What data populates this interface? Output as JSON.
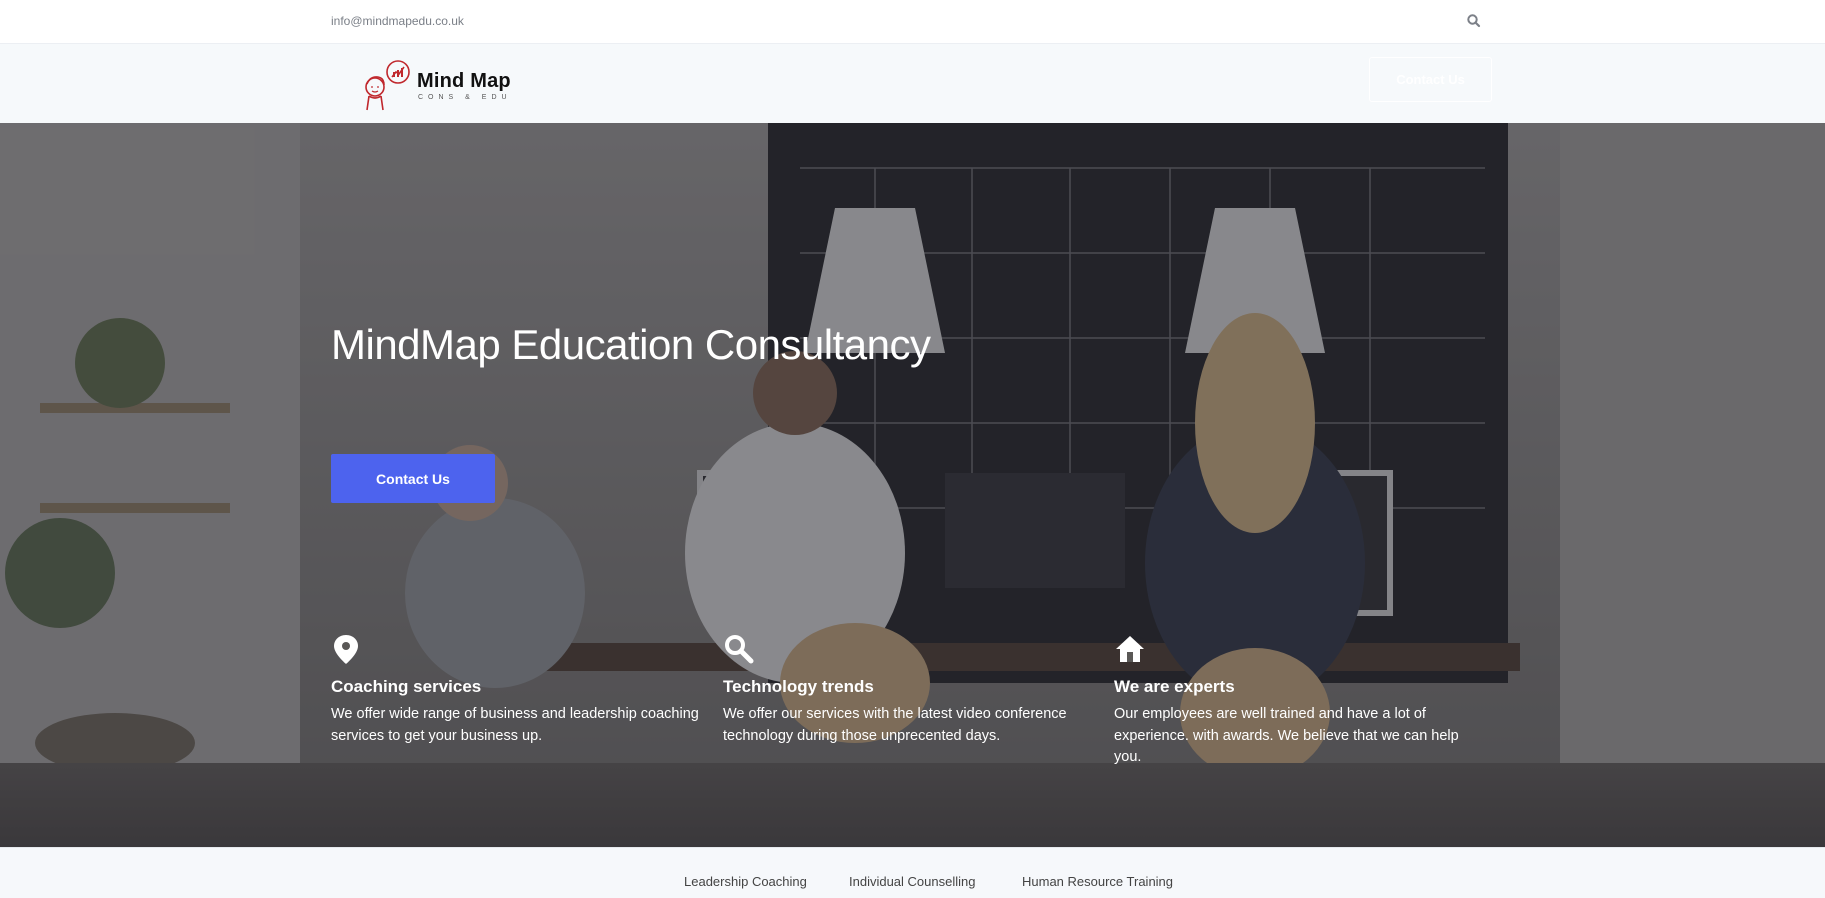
{
  "topbar": {
    "email": "info@mindmapedu.co.uk",
    "search_icon": "search-icon"
  },
  "header": {
    "logo": {
      "name": "Mind Map",
      "tagline": "CONS & EDU"
    },
    "cta_label": "Contact Us"
  },
  "hero": {
    "title": "MindMap Education Consultancy",
    "cta_label": "Contact Us",
    "features": [
      {
        "icon": "map-pin-icon",
        "title": "Coaching services",
        "text": "We offer wide range of business and leadership coaching services to get your business up."
      },
      {
        "icon": "search-icon",
        "title": "Technology trends",
        "text": "We offer our services with the latest video conference technology during those unprecented days."
      },
      {
        "icon": "home-icon",
        "title": "We are experts",
        "text": "Our employees are well trained and have a lot of experience. with awards. We believe that we can help you."
      }
    ]
  },
  "footer_links": [
    "Leadership Coaching",
    "Individual Counselling",
    "Human Resource Training"
  ],
  "colors": {
    "accent": "#4d63ee",
    "hero_overlay": "#28283a"
  }
}
